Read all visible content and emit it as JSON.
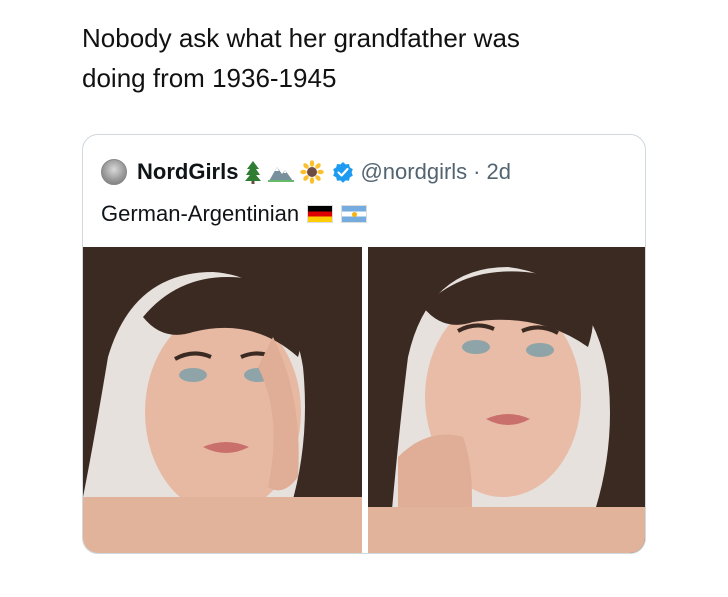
{
  "post": {
    "text_line1": "Nobody ask what her grandfather was",
    "text_line2": "doing from 1936-1945"
  },
  "quote": {
    "display_name": "NordGirls",
    "icons": [
      "evergreen-tree-icon",
      "mountain-icon",
      "sunflower-icon",
      "verified-badge-icon"
    ],
    "handle": "@nordgirls",
    "separator": "·",
    "time": "2d",
    "body_text": "German-Argentinian",
    "flags": [
      "germany-flag-icon",
      "argentina-flag-icon"
    ],
    "photos": [
      "photo-left",
      "photo-right"
    ]
  },
  "colors": {
    "verified": "#1d9bf0",
    "muted_text": "#536471",
    "border": "#cfd9de"
  }
}
